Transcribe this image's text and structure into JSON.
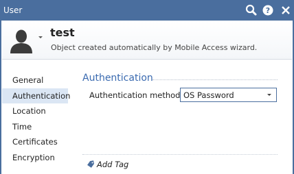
{
  "window": {
    "title": "User"
  },
  "header": {
    "name": "test",
    "comment": "Object created automatically by Mobile Access wizard."
  },
  "nav": {
    "items": [
      {
        "label": "General"
      },
      {
        "label": "Authentication"
      },
      {
        "label": "Location"
      },
      {
        "label": "Time"
      },
      {
        "label": "Certificates"
      },
      {
        "label": "Encryption"
      }
    ],
    "active": "Authentication"
  },
  "section": {
    "title": "Authentication",
    "method_label": "Authentication method:",
    "method_value": "OS Password"
  },
  "footer": {
    "add_tag": "Add Tag"
  },
  "colors": {
    "titlebar": "#4a6e9e",
    "section_title": "#3a6ab0",
    "nav_active": "#dbe6f4"
  },
  "icons": [
    "search-icon",
    "help-icon",
    "close-icon",
    "user-avatar-icon",
    "tag-icon"
  ]
}
